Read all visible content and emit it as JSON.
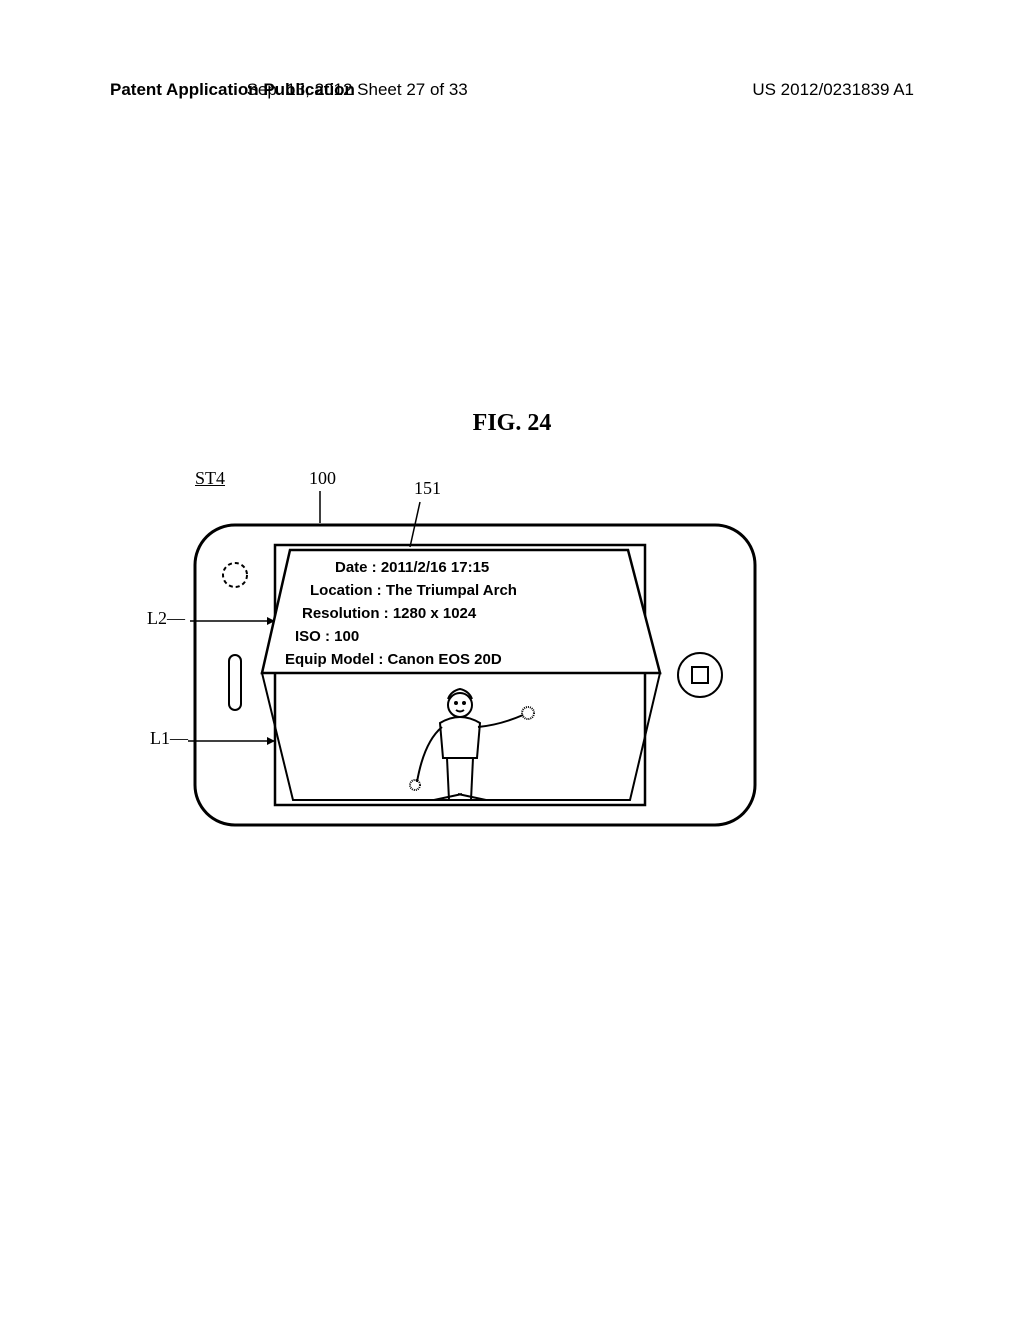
{
  "header": {
    "left": "Patent Application Publication",
    "center": "Sep. 13, 2012  Sheet 27 of 33",
    "right": "US 2012/0231839 A1"
  },
  "figure": {
    "title": "FIG. 24",
    "step": "ST4",
    "ref100": "100",
    "ref151": "151",
    "L1": "L1",
    "L2": "L2"
  },
  "info_panel": {
    "line1": "Date : 2011/2/16  17:15",
    "line2": "Location : The Triumpal Arch",
    "line3": "Resolution : 1280 x 1024",
    "line4": "ISO : 100",
    "line5": "Equip Model : Canon EOS 20D"
  }
}
